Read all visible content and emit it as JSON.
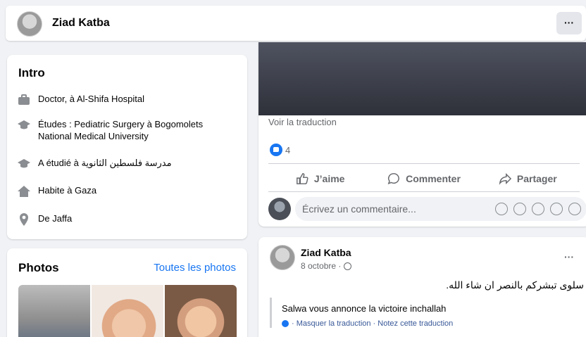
{
  "profile": {
    "name": "Ziad Katba",
    "more_label": "···"
  },
  "intro": {
    "title": "Intro",
    "items": [
      {
        "icon": "briefcase-icon",
        "text": "Doctor, à Al-Shifa Hospital"
      },
      {
        "icon": "graduation-cap-icon",
        "text": "Études : Pediatric Surgery à Bogomolets National Medical University"
      },
      {
        "icon": "graduation-cap-icon",
        "text": "A étudié à مدرسة فلسطين الثانوية"
      },
      {
        "icon": "home-icon",
        "text": "Habite à Gaza"
      },
      {
        "icon": "location-pin-icon",
        "text": "De Jaffa"
      }
    ]
  },
  "photos": {
    "title": "Photos",
    "all_label": "Toutes les photos"
  },
  "post1": {
    "see_translation": "Voir la traduction",
    "reaction_count": "4",
    "actions": {
      "like": "J’aime",
      "comment": "Commenter",
      "share": "Partager"
    },
    "comment_placeholder": "Écrivez un commentaire..."
  },
  "post2": {
    "author": "Ziad Katba",
    "date": "8 octobre ·",
    "more_label": "···",
    "text": "سلوى تبشركم بالنصر ان شاء الله.",
    "translation": "Salwa vous annonce la victoire inchallah",
    "translation_links": "· Masquer la traduction · Notez cette traduction"
  },
  "colors": {
    "accent": "#1876f2",
    "bg": "#f0f2f5",
    "card": "#ffffff",
    "muted": "#65676b"
  }
}
